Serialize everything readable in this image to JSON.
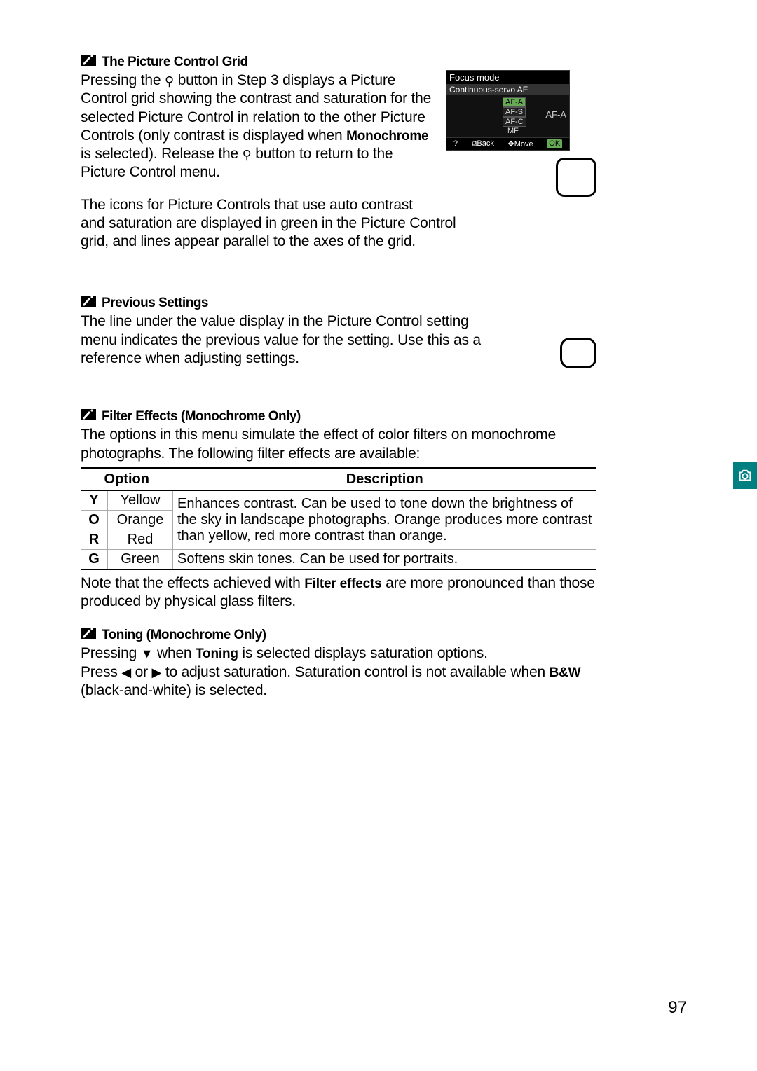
{
  "section1": {
    "title": "The Picture Control Grid",
    "para1_a": "Pressing the ",
    "para1_b": " button in Step 3 displays a Picture Control grid showing the contrast and saturation for the selected Picture Control in relation to the other Picture Controls (only contrast is displayed when ",
    "mono": "Monochrome",
    "para1_c": " is selected).  Release the ",
    "para1_d": " button to return to the Picture Control menu.",
    "para2": "The icons for Picture Controls that use auto contrast and saturation are displayed in green in the Picture Control grid, and lines appear parallel to the axes of the grid."
  },
  "lcd": {
    "title": "Focus mode",
    "subtitle": "Continuous-servo AF",
    "opts": [
      "AF-A",
      "AF-S",
      "AF-C",
      "MF"
    ],
    "side": "AF-A",
    "footer_q": "?",
    "footer_back": "Back",
    "footer_move": "Move",
    "footer_ok": "OK"
  },
  "section2": {
    "title": "Previous Settings",
    "para": "The line under the value display in the Picture Control setting menu indicates the previous value for the setting.  Use this as a reference when adjusting settings."
  },
  "section3": {
    "title": "Filter Effects (Monochrome Only)",
    "para": "The options in this menu simulate the effect of color filters on monochrome photographs. The following filter effects are available:",
    "table": {
      "head_option": "Option",
      "head_desc": "Description",
      "rows": [
        {
          "code": "Y",
          "name": "Yellow"
        },
        {
          "code": "O",
          "name": "Orange"
        },
        {
          "code": "R",
          "name": "Red"
        },
        {
          "code": "G",
          "name": "Green"
        }
      ],
      "desc_combined": "Enhances contrast.  Can be used to tone down the brightness of the sky in landscape photographs.  Orange produces more contrast than yellow, red more contrast than orange.",
      "desc_green": "Softens skin tones.  Can be used for portraits."
    },
    "note_a": "Note that the effects achieved with ",
    "note_bold": "Filter effects",
    "note_b": " are more pronounced than those produced by physical glass filters."
  },
  "section4": {
    "title": "Toning (Monochrome Only)",
    "line1_a": "Pressing ",
    "line1_b": " when ",
    "line1_bold": "Toning",
    "line1_c": " is selected displays saturation options.",
    "line2_a": "Press ",
    "line2_b": " or ",
    "line2_c": " to adjust saturation.  Saturation control is not available when ",
    "bw": "B&W",
    "line2_d": " (black-and-white) is selected."
  },
  "page_number": "97"
}
